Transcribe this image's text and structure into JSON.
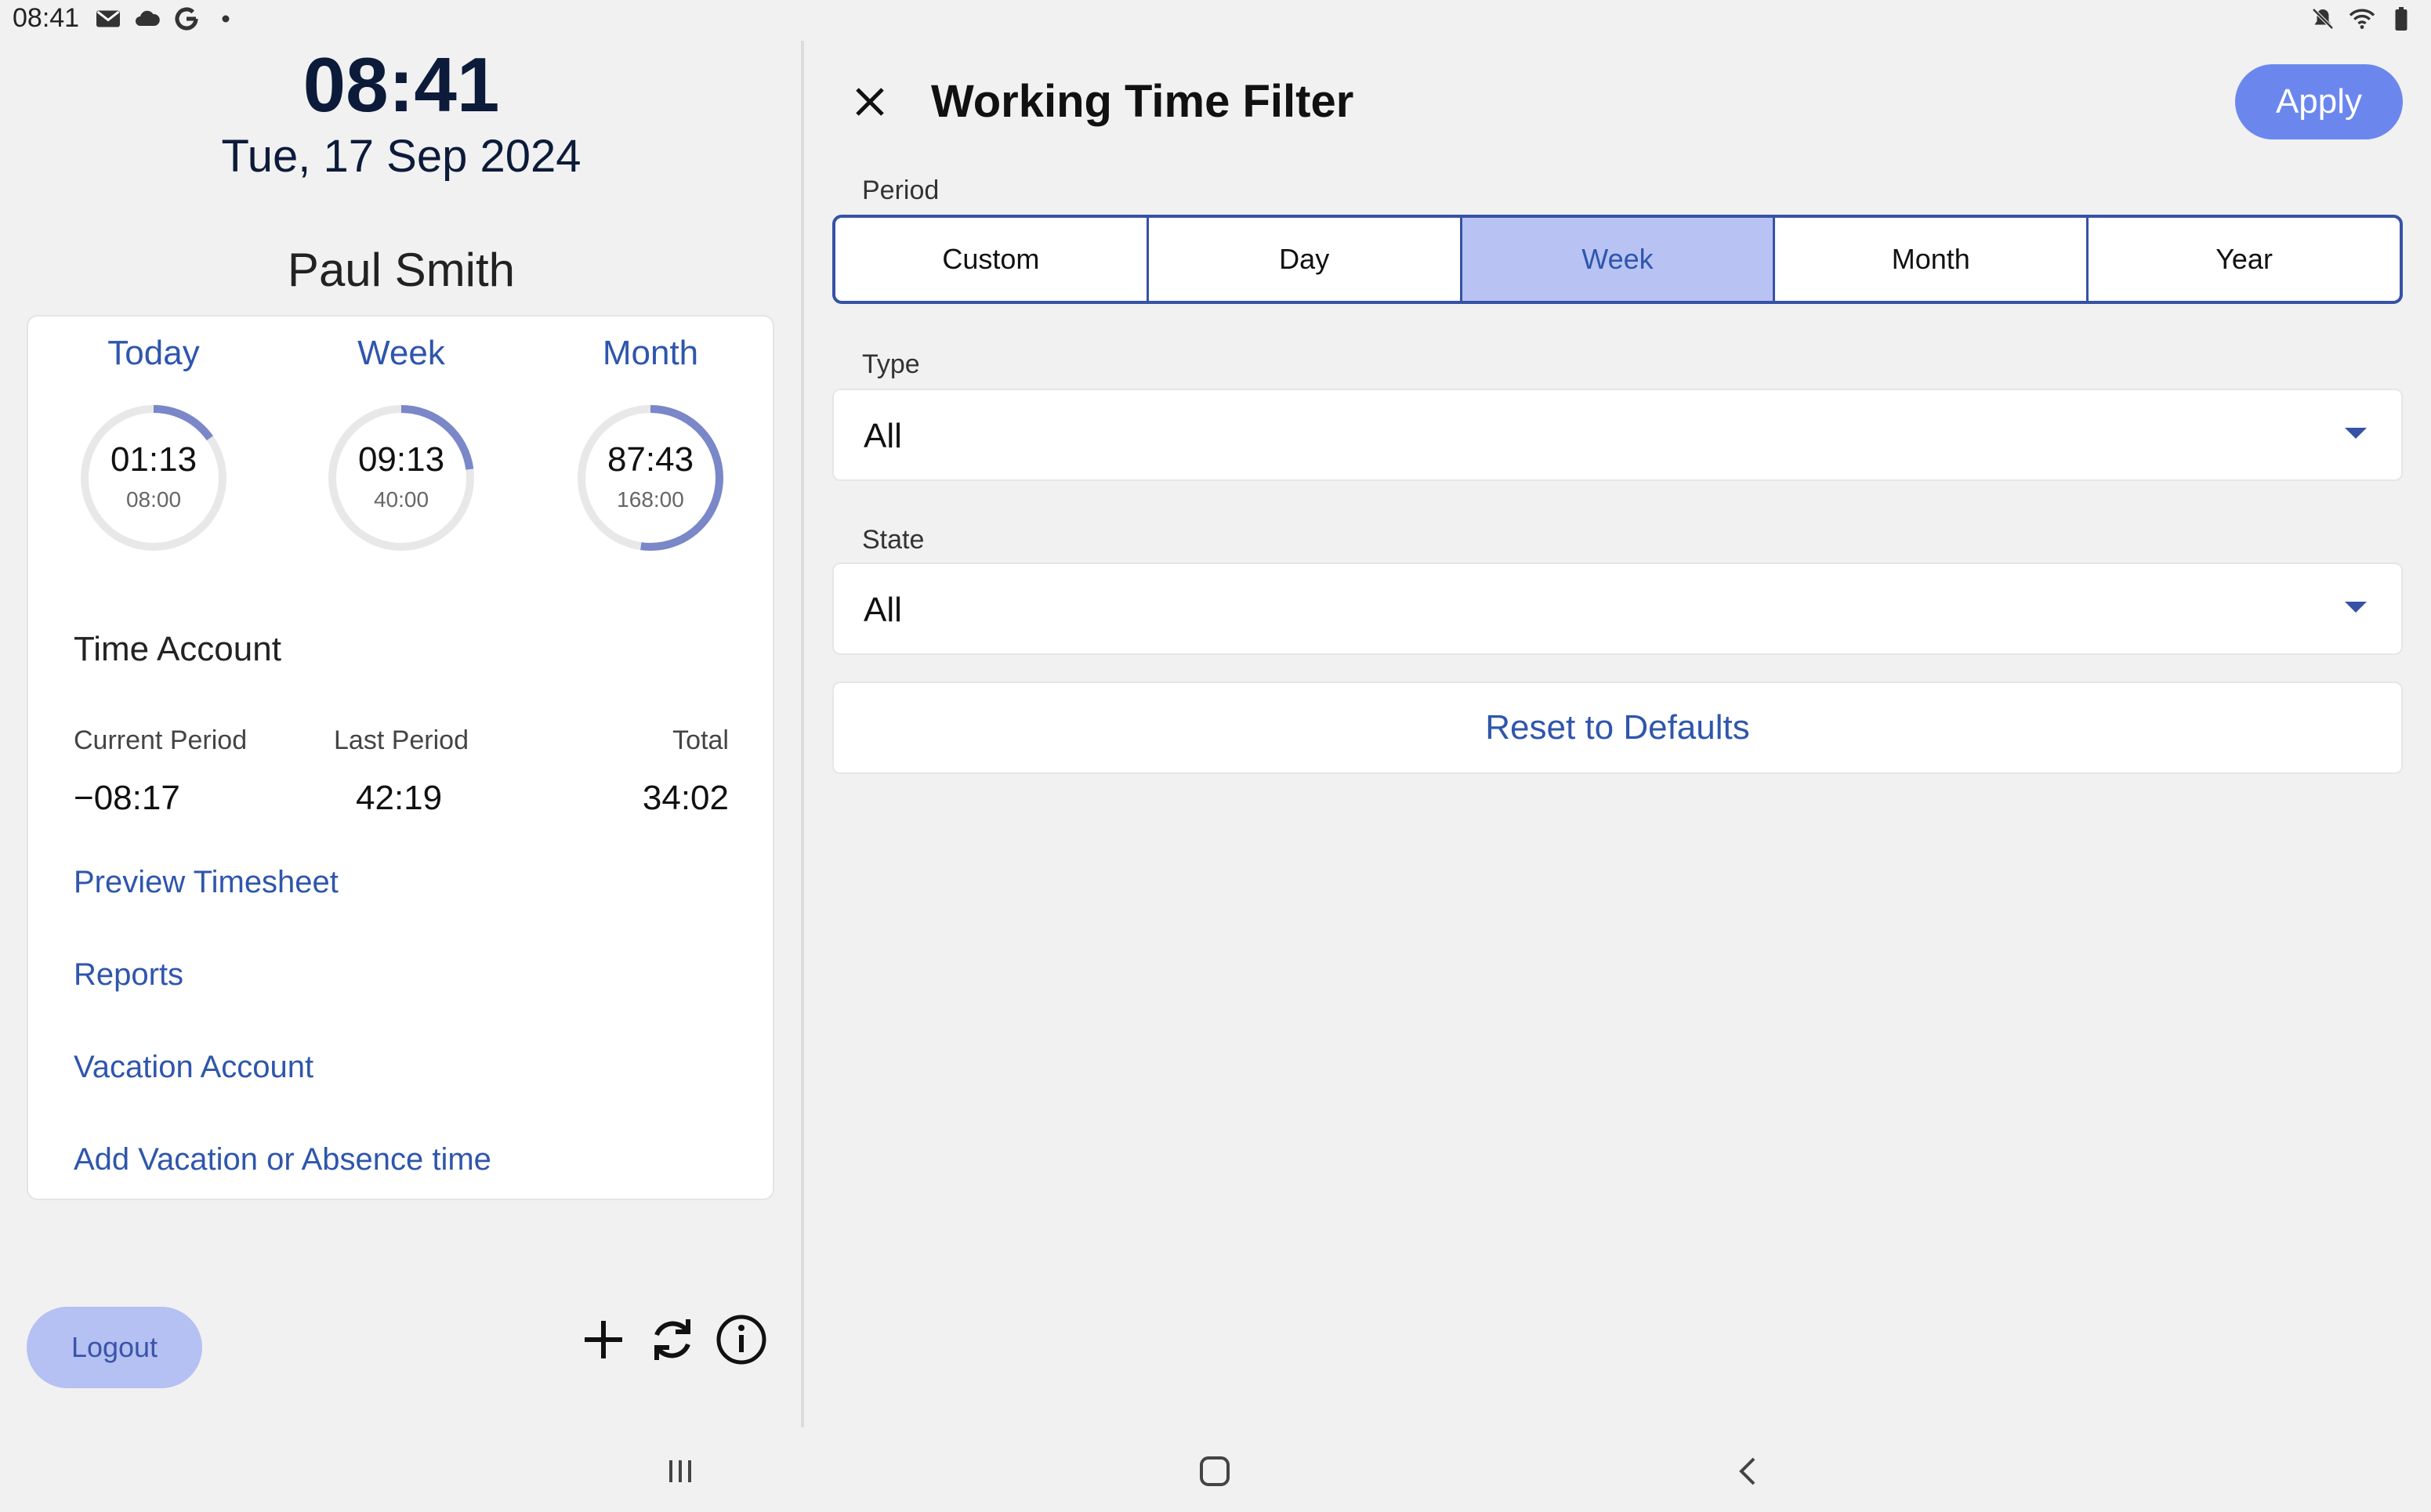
{
  "status_bar": {
    "time": "08:41",
    "left_icons": [
      "mail-icon",
      "cloud-icon",
      "google-icon",
      "dot-icon"
    ],
    "right_icons": [
      "mute-icon",
      "wifi-icon",
      "battery-icon"
    ]
  },
  "header": {
    "clock": "08:41",
    "date": "Tue, 17 Sep 2024",
    "user_name": "Paul Smith"
  },
  "gauges": [
    {
      "label": "Today",
      "value": "01:13",
      "goal": "08:00",
      "progress": 0.152
    },
    {
      "label": "Week",
      "value": "09:13",
      "goal": "40:00",
      "progress": 0.23
    },
    {
      "label": "Month",
      "value": "87:43",
      "goal": "168:00",
      "progress": 0.522
    }
  ],
  "time_account": {
    "title": "Time Account",
    "columns": [
      {
        "label": "Current Period",
        "value": "−08:17"
      },
      {
        "label": "Last Period",
        "value": "42:19"
      },
      {
        "label": "Total",
        "value": "34:02"
      }
    ]
  },
  "links": [
    "Preview Timesheet",
    "Reports",
    "Vacation Account",
    "Add Vacation or Absence time"
  ],
  "logout_label": "Logout",
  "filter": {
    "title": "Working Time Filter",
    "apply_label": "Apply",
    "period_label": "Period",
    "periods": [
      "Custom",
      "Day",
      "Week",
      "Month",
      "Year"
    ],
    "selected_period": "Week",
    "type_label": "Type",
    "type_value": "All",
    "state_label": "State",
    "state_value": "All",
    "reset_label": "Reset to Defaults"
  },
  "colors": {
    "accent": "#2f56ac",
    "apply_bg": "#6b87ee",
    "selected_segment": "#b8c3f4",
    "gauge_progress": "#7a87c8",
    "gauge_track": "#e8e8e8"
  }
}
